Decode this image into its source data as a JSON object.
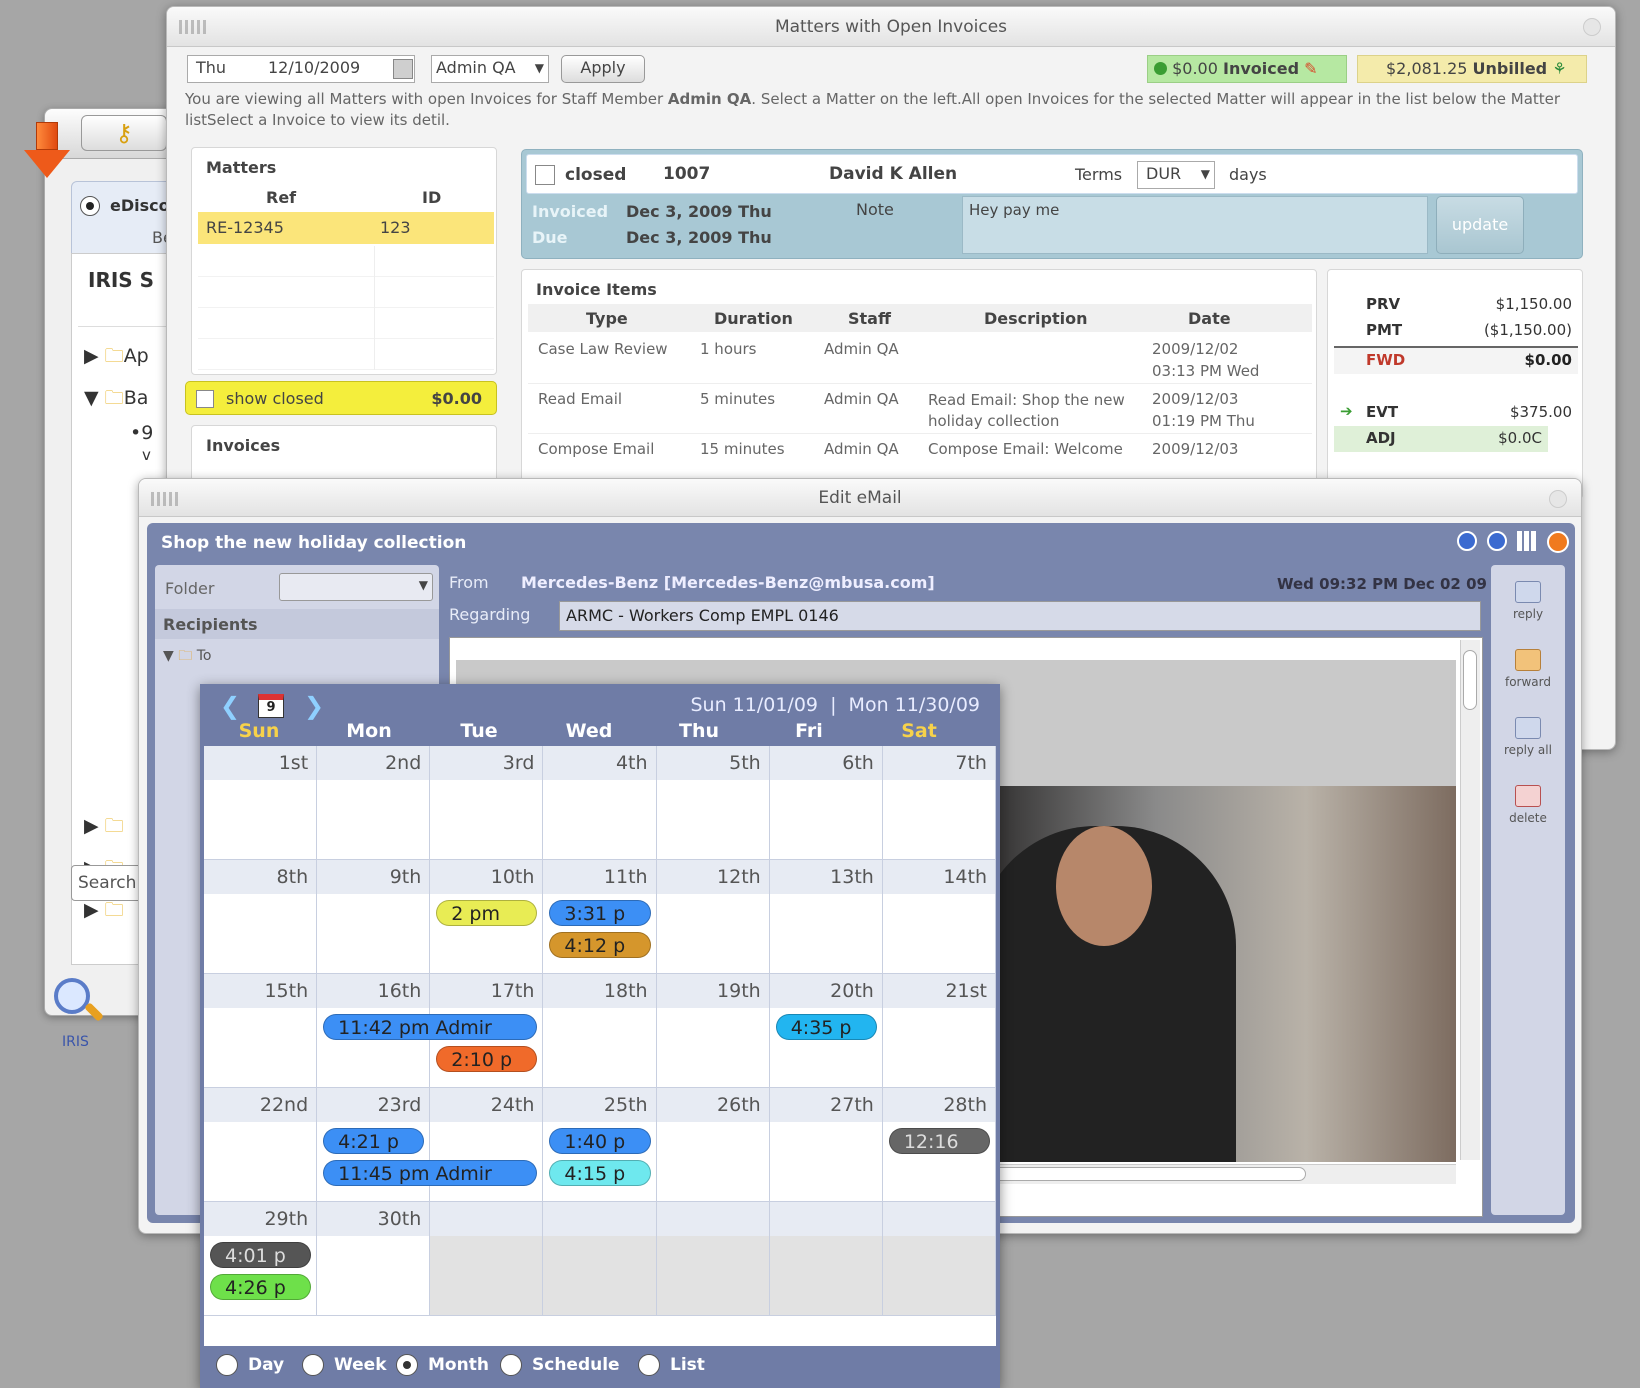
{
  "back_window": {
    "radio_label": "eDisco",
    "radio_sub": "Beta",
    "heading": "IRIS S",
    "tree": [
      "Ap",
      "Ba"
    ],
    "bullet_item": "•9",
    "bullet_item2": "v",
    "search_label": "Search",
    "bottom_label": "IRIS"
  },
  "invoices_window": {
    "title": "Matters with Open Invoices",
    "day": "Thu",
    "date": "12/10/2009",
    "staff_select": "Admin QA",
    "apply": "Apply",
    "invoiced_amount": "$0.00",
    "invoiced_label": "Invoiced",
    "unbilled_amount": "$2,081.25",
    "unbilled_label": "Unbilled",
    "intro_1": "You are viewing all Matters with open Invoices for Staff Member ",
    "intro_staff": "Admin QA",
    "intro_2": ". Select a Matter on the left.All open Invoices for the selected Matter will appear in the list below the Matter listSelect a Invoice to view its detil.",
    "matters_title": "Matters",
    "matters_cols": [
      "Ref",
      "ID"
    ],
    "matters_rows": [
      [
        "RE-12345",
        "123"
      ]
    ],
    "show_closed": "show closed",
    "show_closed_amount": "$0.00",
    "invoices_title": "Invoices",
    "closed_label": "closed",
    "invoice_number": "1007",
    "client": "David K Allen",
    "terms_label": "Terms",
    "terms_value": "DUR",
    "days_label": "days",
    "invoiced_row_label": "Invoiced",
    "invoiced_date": "Dec 3, 2009 Thu",
    "due_label": "Due",
    "due_date": "Dec 3, 2009 Thu",
    "note_label": "Note",
    "note_value": "Hey pay me",
    "update": "update",
    "items_title": "Invoice Items",
    "items_cols": [
      "Type",
      "Duration",
      "Staff",
      "Description",
      "Date"
    ],
    "items": [
      {
        "type": "Case Law Review",
        "duration": "1 hours",
        "staff": "Admin QA",
        "desc": "",
        "date1": "2009/12/02",
        "date2": "03:13 PM Wed"
      },
      {
        "type": "Read Email",
        "duration": "5 minutes",
        "staff": "Admin QA",
        "desc": "Read Email: Shop the new holiday collection",
        "date1": "2009/12/03",
        "date2": "01:19 PM Thu"
      },
      {
        "type": "Compose Email",
        "duration": "15 minutes",
        "staff": "Admin QA",
        "desc": "Compose Email: Welcome",
        "date1": "2009/12/03",
        "date2": ""
      }
    ],
    "summary": [
      {
        "k": "PRV",
        "v": "$1,150.00"
      },
      {
        "k": "PMT",
        "v": "($1,150.00)"
      },
      {
        "k": "FWD",
        "v": "$0.00"
      },
      {
        "k": "EVT",
        "v": "$375.00"
      },
      {
        "k": "ADJ",
        "v": "$0.0C"
      }
    ]
  },
  "email_window": {
    "title": "Edit eMail",
    "subject": "Shop the new holiday collection",
    "folder_label": "Folder",
    "recipients_label": "Recipients",
    "to_label": "To",
    "from_label": "From",
    "from_value": "Mercedes-Benz [Mercedes-Benz@mbusa.com]",
    "sent_date": "Wed 09:32 PM  Dec 02 09",
    "regarding_label": "Regarding",
    "regarding_value": "ARMC - Workers Comp EMPL 0146",
    "actions": [
      "reply",
      "forward",
      "reply all",
      "delete"
    ]
  },
  "calendar": {
    "cal_icon_day": "9",
    "range": "Sun 11/01/09  |  Mon 11/30/09",
    "dows": [
      "Sun",
      "Mon",
      "Tue",
      "Wed",
      "Thu",
      "Fri",
      "Sat"
    ],
    "weeks": [
      [
        "1st",
        "2nd",
        "3rd",
        "4th",
        "5th",
        "6th",
        "7th"
      ],
      [
        "8th",
        "9th",
        "10th",
        "11th",
        "12th",
        "13th",
        "14th"
      ],
      [
        "15th",
        "16th",
        "17th",
        "18th",
        "19th",
        "20th",
        "21st"
      ],
      [
        "22nd",
        "23rd",
        "24th",
        "25th",
        "26th",
        "27th",
        "28th"
      ],
      [
        "29th",
        "30th",
        "",
        "",
        "",
        "",
        ""
      ]
    ],
    "events": [
      {
        "week": 1,
        "day": 2,
        "span": 1,
        "slot": 0,
        "label": "2 pm",
        "color": "#e8ec54"
      },
      {
        "week": 1,
        "day": 3,
        "span": 1,
        "slot": 0,
        "label": "3:31 p",
        "color": "#3c8ff5"
      },
      {
        "week": 1,
        "day": 3,
        "span": 1,
        "slot": 1,
        "label": "4:12 p",
        "color": "#d5962c"
      },
      {
        "week": 2,
        "day": 1,
        "span": 2,
        "slot": 0,
        "label": "11:42 pm  Admir",
        "color": "#3c8ff5"
      },
      {
        "week": 2,
        "day": 2,
        "span": 1,
        "slot": 1,
        "label": "2:10 p",
        "color": "#f06a2a"
      },
      {
        "week": 2,
        "day": 5,
        "span": 1,
        "slot": 0,
        "label": "4:35 p",
        "color": "#22b5f0"
      },
      {
        "week": 3,
        "day": 1,
        "span": 1,
        "slot": 0,
        "label": "4:21 p",
        "color": "#3c8ff5"
      },
      {
        "week": 3,
        "day": 1,
        "span": 2,
        "slot": 1,
        "label": "11:45 pm  Admir",
        "color": "#3c8ff5"
      },
      {
        "week": 3,
        "day": 3,
        "span": 1,
        "slot": 0,
        "label": "1:40 p",
        "color": "#3c8ff5"
      },
      {
        "week": 3,
        "day": 3,
        "span": 1,
        "slot": 1,
        "label": "4:15 p",
        "color": "#6ee8ee"
      },
      {
        "week": 3,
        "day": 6,
        "span": 1,
        "slot": 0,
        "label": "12:16",
        "color": "#666666"
      },
      {
        "week": 4,
        "day": 0,
        "span": 1,
        "slot": 0,
        "label": "4:01 p",
        "color": "#555555"
      },
      {
        "week": 4,
        "day": 0,
        "span": 1,
        "slot": 1,
        "label": "4:26 p",
        "color": "#6ee04a"
      }
    ],
    "views": [
      {
        "label": "Day",
        "selected": false
      },
      {
        "label": "Week",
        "selected": false
      },
      {
        "label": "Month",
        "selected": true
      },
      {
        "label": "Schedule",
        "selected": false
      },
      {
        "label": "List",
        "selected": false
      }
    ]
  }
}
